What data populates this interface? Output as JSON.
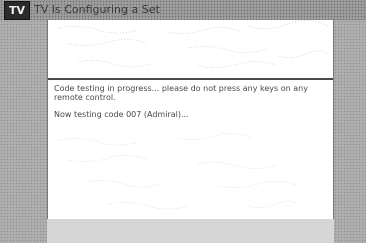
{
  "window": {
    "logo_text": "TV",
    "title": "TV Is Configuring a Set"
  },
  "status": {
    "message": "Code testing in progress... please do not press any keys on any remote control.",
    "testing_line": "Now testing code 007 (Admiral)..."
  },
  "colors": {
    "background_texture": "#c9c9c9",
    "panel_background": "#ffffff",
    "divider": "#4a4a4a",
    "text": "#4a4a4a"
  }
}
